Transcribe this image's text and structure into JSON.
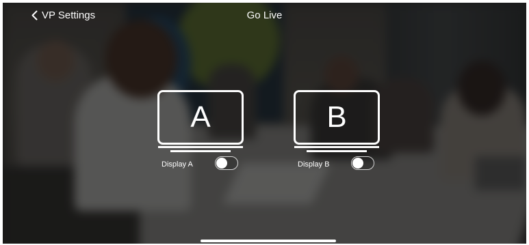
{
  "nav": {
    "back_label": "VP Settings",
    "back_icon": "chevron-left-icon",
    "title": "Go Live"
  },
  "displays": [
    {
      "letter": "A",
      "label": "Display A",
      "toggle_on": false,
      "icon": "monitor-icon"
    },
    {
      "letter": "B",
      "label": "Display B",
      "toggle_on": false,
      "icon": "monitor-icon"
    }
  ],
  "colors": {
    "foreground": "#ffffff",
    "overlay": "rgba(0,0,0,0.38)"
  }
}
